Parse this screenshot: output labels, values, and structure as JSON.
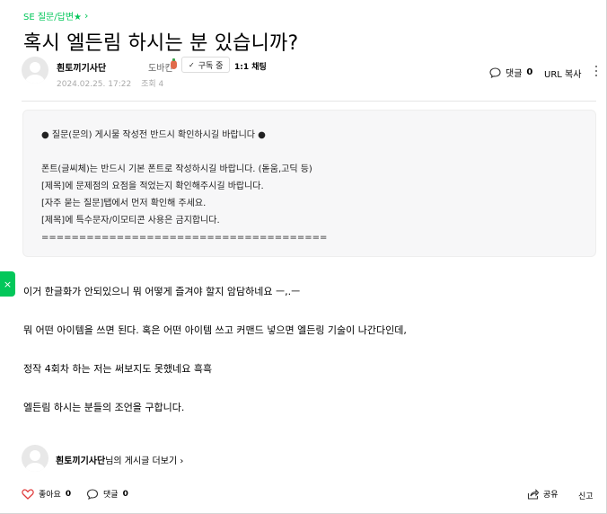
{
  "breadcrumb": {
    "label": "SE 질문/답변★",
    "chevron": "›"
  },
  "post": {
    "title": "혹시 엘든림 하시는 분 있습니까?",
    "author": "흰토끼기사단",
    "grade": "도바킨",
    "follow_label": "구독 중",
    "chat_label": "1:1 채팅",
    "date": "2024.02.25. 17:22",
    "views": "조회 4",
    "comment_label": "댓글",
    "comment_count": "0",
    "url_copy_label": "URL 복사"
  },
  "notice": {
    "line1": "● 질문(문의) 게시물 작성전 반드시 확인하시길 바랍니다 ●",
    "line2": "폰트(글씨체)는 반드시 기본 폰트로 작성하시길 바랍니다. (돋움,고딕 등)",
    "line3": "[제목]에 문제점의 요점을 적었는지 확인해주시길 바랍니다.",
    "line4": "[자주 묻는 질문]탭에서 먼저 확인해 주세요.",
    "line5": "[제목]에 특수문자/이모티콘 사용은 금지합니다.",
    "line6": "======================================"
  },
  "body": {
    "p1": "이거 한글화가 안되있으니 뭐 어떻게 즐겨야 할지 암담하네요 ㅡ,.ㅡ",
    "p2": "뭐 어떤 아이템을 쓰면 된다. 혹은 어떤 아이템 쓰고 커맨드 넣으면 엘든링 기술이 나간다인데,",
    "p3": "정작 4회차 하는 저는 써보지도 못했네요 흑흑",
    "p4": "엘든림 하시는 분들의 조언을 구합니다."
  },
  "author_more": {
    "name": "흰토끼기사단",
    "suffix": "님의 게시글 더보기",
    "chevron": "›"
  },
  "footer": {
    "like_label": "좋아요",
    "like_count": "0",
    "comment_label": "댓글",
    "comment_count": "0",
    "share_label": "공유",
    "report_label": "신고"
  },
  "side_handle": {
    "label": "×"
  },
  "icons": {
    "heart": "heart-icon",
    "comment": "comment-icon",
    "share": "share-icon",
    "more": "more-vertical-icon"
  },
  "colors": {
    "accent": "#03c75a",
    "heart": "#e03c3c"
  }
}
